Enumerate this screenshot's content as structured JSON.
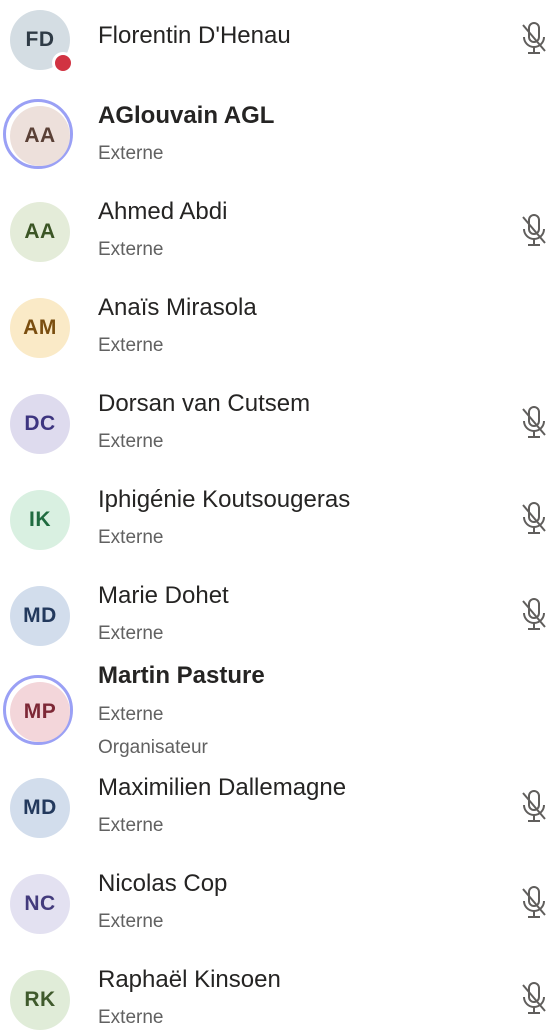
{
  "participants": [
    {
      "initials": "FD",
      "name": "Florentin D'Henau",
      "subtitle": "",
      "role": "",
      "avatar_bg": "#d4dde3",
      "avatar_fg": "#2f3b46",
      "muted": true,
      "highlighted": false,
      "status": "busy",
      "bold": false
    },
    {
      "initials": "AA",
      "name": "AGlouvain AGL",
      "subtitle": "Externe",
      "role": "",
      "avatar_bg": "#ede0db",
      "avatar_fg": "#5a4036",
      "muted": false,
      "highlighted": true,
      "status": "",
      "bold": true
    },
    {
      "initials": "AA",
      "name": "Ahmed Abdi",
      "subtitle": "Externe",
      "role": "",
      "avatar_bg": "#e4ecd9",
      "avatar_fg": "#3b5525",
      "muted": true,
      "highlighted": false,
      "status": "",
      "bold": false
    },
    {
      "initials": "AM",
      "name": "Anaïs Mirasola",
      "subtitle": "Externe",
      "role": "",
      "avatar_bg": "#faeac7",
      "avatar_fg": "#7a4e10",
      "muted": false,
      "highlighted": false,
      "status": "",
      "bold": false
    },
    {
      "initials": "DC",
      "name": "Dorsan van Cutsem",
      "subtitle": "Externe",
      "role": "",
      "avatar_bg": "#dedbee",
      "avatar_fg": "#3d3580",
      "muted": true,
      "highlighted": false,
      "status": "",
      "bold": false
    },
    {
      "initials": "IK",
      "name": "Iphigénie Koutsougeras",
      "subtitle": "Externe",
      "role": "",
      "avatar_bg": "#d9f0e1",
      "avatar_fg": "#1f6b3f",
      "muted": true,
      "highlighted": false,
      "status": "",
      "bold": false
    },
    {
      "initials": "MD",
      "name": "Marie Dohet",
      "subtitle": "Externe",
      "role": "",
      "avatar_bg": "#d2ddec",
      "avatar_fg": "#23395d",
      "muted": true,
      "highlighted": false,
      "status": "",
      "bold": false
    },
    {
      "initials": "MP",
      "name": "Martin Pasture",
      "subtitle": "Externe",
      "role": "Organisateur",
      "avatar_bg": "#f3d6da",
      "avatar_fg": "#7d2836",
      "muted": false,
      "highlighted": true,
      "status": "",
      "bold": true
    },
    {
      "initials": "MD",
      "name": "Maximilien Dallemagne",
      "subtitle": "Externe",
      "role": "",
      "avatar_bg": "#d2ddec",
      "avatar_fg": "#23395d",
      "muted": true,
      "highlighted": false,
      "status": "",
      "bold": false
    },
    {
      "initials": "NC",
      "name": "Nicolas Cop",
      "subtitle": "Externe",
      "role": "",
      "avatar_bg": "#e3e1f1",
      "avatar_fg": "#433b7d",
      "muted": true,
      "highlighted": false,
      "status": "",
      "bold": false
    },
    {
      "initials": "RK",
      "name": "Raphaël Kinsoen",
      "subtitle": "Externe",
      "role": "",
      "avatar_bg": "#e0ecd8",
      "avatar_fg": "#3f5a2c",
      "muted": true,
      "highlighted": false,
      "status": "",
      "bold": false
    }
  ],
  "icons": {
    "muted": "mic-off-icon",
    "status_busy": "busy-status-icon"
  },
  "colors": {
    "ring": "#9aa0f5",
    "busy": "#d13342",
    "name_text": "#252423",
    "sub_text": "#616161",
    "mic": "#605e5c"
  }
}
